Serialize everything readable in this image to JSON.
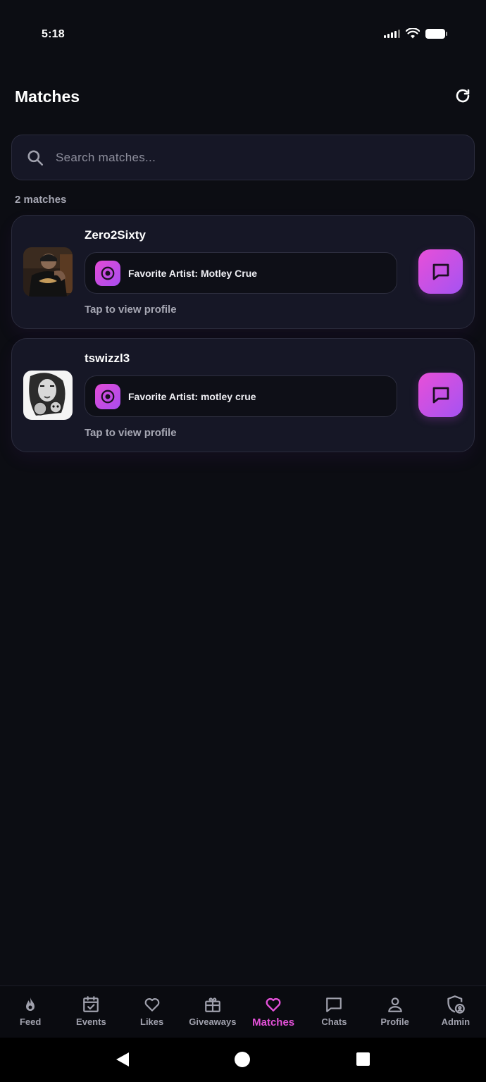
{
  "status_bar": {
    "time": "5:18"
  },
  "header": {
    "title": "Matches"
  },
  "search": {
    "placeholder": "Search matches..."
  },
  "match_count": "2 matches",
  "matches": [
    {
      "name": "Zero2Sixty",
      "artist": "Favorite Artist: Motley Crue",
      "hint": "Tap to view profile"
    },
    {
      "name": "tswizzl3",
      "artist": "Favorite Artist: motley crue",
      "hint": "Tap to view profile"
    }
  ],
  "bottom_nav": [
    {
      "label": "Feed",
      "icon": "flame-icon"
    },
    {
      "label": "Events",
      "icon": "calendar-check-icon"
    },
    {
      "label": "Likes",
      "icon": "heart-icon"
    },
    {
      "label": "Giveaways",
      "icon": "gift-icon"
    },
    {
      "label": "Matches",
      "icon": "heart-icon",
      "active": true
    },
    {
      "label": "Chats",
      "icon": "message-icon"
    },
    {
      "label": "Profile",
      "icon": "user-icon"
    },
    {
      "label": "Admin",
      "icon": "shield-user-icon"
    }
  ],
  "colors": {
    "accent": "#e451d9",
    "accent_alt": "#a553f2",
    "background": "#0c0d13",
    "card": "#161726"
  }
}
